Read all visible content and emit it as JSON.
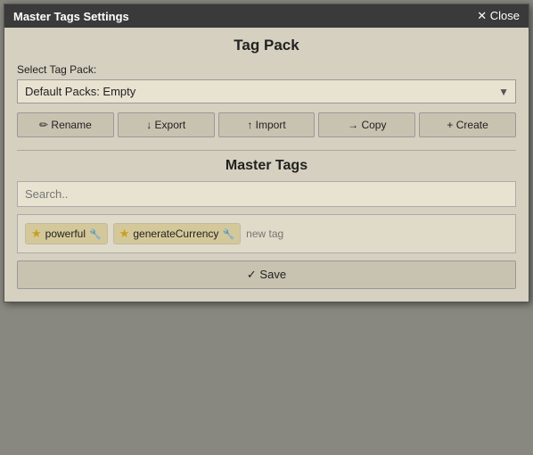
{
  "titleBar": {
    "title": "Master Tags Settings",
    "closeLabel": "✕ Close"
  },
  "tagPackSection": {
    "sectionTitle": "Tag Pack",
    "selectLabel": "Select Tag Pack:",
    "selectValue": "Default Packs: Empty",
    "selectOptions": [
      "Default Packs: Empty"
    ]
  },
  "toolbar": {
    "renameLabel": "✏ Rename",
    "exportLabel": "↓ Export",
    "importLabel": "↑ Import",
    "copyLabel": "→ Copy",
    "createLabel": "+ Create"
  },
  "masterTagsSection": {
    "sectionTitle": "Master Tags",
    "searchPlaceholder": "Search..",
    "tags": [
      {
        "name": "powerful",
        "hasStar": true,
        "hasWrench": true
      },
      {
        "name": "generateCurrency",
        "hasStar": true,
        "hasWrench": true
      }
    ],
    "newTagPlaceholder": "new tag",
    "saveLabel": "✓ Save"
  }
}
